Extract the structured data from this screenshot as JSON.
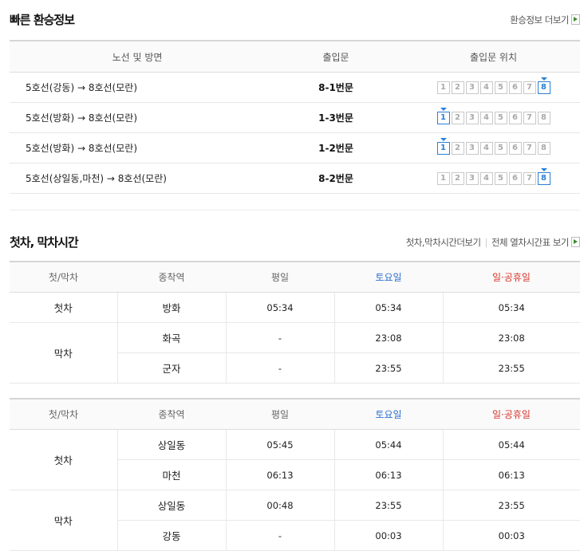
{
  "transfer": {
    "title": "빠른 환승정보",
    "more_label": "환승정보 더보기",
    "headers": {
      "route": "노선 및 방면",
      "exit": "출입문",
      "position": "출입문 위치"
    },
    "car_labels": [
      "1",
      "2",
      "3",
      "4",
      "5",
      "6",
      "7",
      "8"
    ],
    "rows": [
      {
        "route": "5호선(강동) → 8호선(모란)",
        "exit": "8-1번문",
        "active_car": 8
      },
      {
        "route": "5호선(방화) → 8호선(모란)",
        "exit": "1-3번문",
        "active_car": 1
      },
      {
        "route": "5호선(방화) → 8호선(모란)",
        "exit": "1-2번문",
        "active_car": 1
      },
      {
        "route": "5호선(상일동,마천) → 8호선(모란)",
        "exit": "8-2번문",
        "active_car": 8
      }
    ]
  },
  "timetable": {
    "title": "첫차, 막차시간",
    "link1": "첫차,막차시간더보기",
    "link2": "전체 열차시간표 보기",
    "headers": {
      "kind": "첫/막차",
      "terminal": "종착역",
      "weekday": "평일",
      "saturday": "토요일",
      "holiday": "일·공휴일"
    },
    "table1": {
      "first_label": "첫차",
      "last_label": "막차",
      "first": [
        {
          "terminal": "방화",
          "weekday": "05:34",
          "saturday": "05:34",
          "holiday": "05:34"
        }
      ],
      "last": [
        {
          "terminal": "화곡",
          "weekday": "-",
          "saturday": "23:08",
          "holiday": "23:08"
        },
        {
          "terminal": "군자",
          "weekday": "-",
          "saturday": "23:55",
          "holiday": "23:55"
        }
      ]
    },
    "table2": {
      "first_label": "첫차",
      "last_label": "막차",
      "first": [
        {
          "terminal": "상일동",
          "weekday": "05:45",
          "saturday": "05:44",
          "holiday": "05:44"
        },
        {
          "terminal": "마천",
          "weekday": "06:13",
          "saturday": "06:13",
          "holiday": "06:13"
        }
      ],
      "last": [
        {
          "terminal": "상일동",
          "weekday": "00:48",
          "saturday": "23:55",
          "holiday": "23:55"
        },
        {
          "terminal": "강동",
          "weekday": "-",
          "saturday": "00:03",
          "holiday": "00:03"
        }
      ]
    }
  }
}
